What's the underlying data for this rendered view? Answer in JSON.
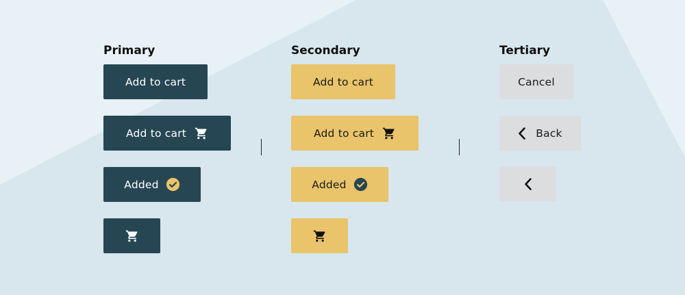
{
  "colors": {
    "primary": "#264653",
    "secondary": "#e9c46a",
    "tertiary": "#dcdddf",
    "background_light": "#e8f1f5",
    "background": "#d8e6ee"
  },
  "columns": {
    "primary": {
      "heading": "Primary",
      "add_to_cart": "Add to cart",
      "add_to_cart_with_icon": "Add to cart",
      "added": "Added"
    },
    "secondary": {
      "heading": "Secondary",
      "add_to_cart": "Add to cart",
      "add_to_cart_with_icon": "Add to cart",
      "added": "Added"
    },
    "tertiary": {
      "heading": "Tertiary",
      "cancel": "Cancel",
      "back": "Back"
    }
  },
  "icons": {
    "cart": "cart-icon",
    "check": "check-circle-icon",
    "back": "chevron-left-icon"
  }
}
